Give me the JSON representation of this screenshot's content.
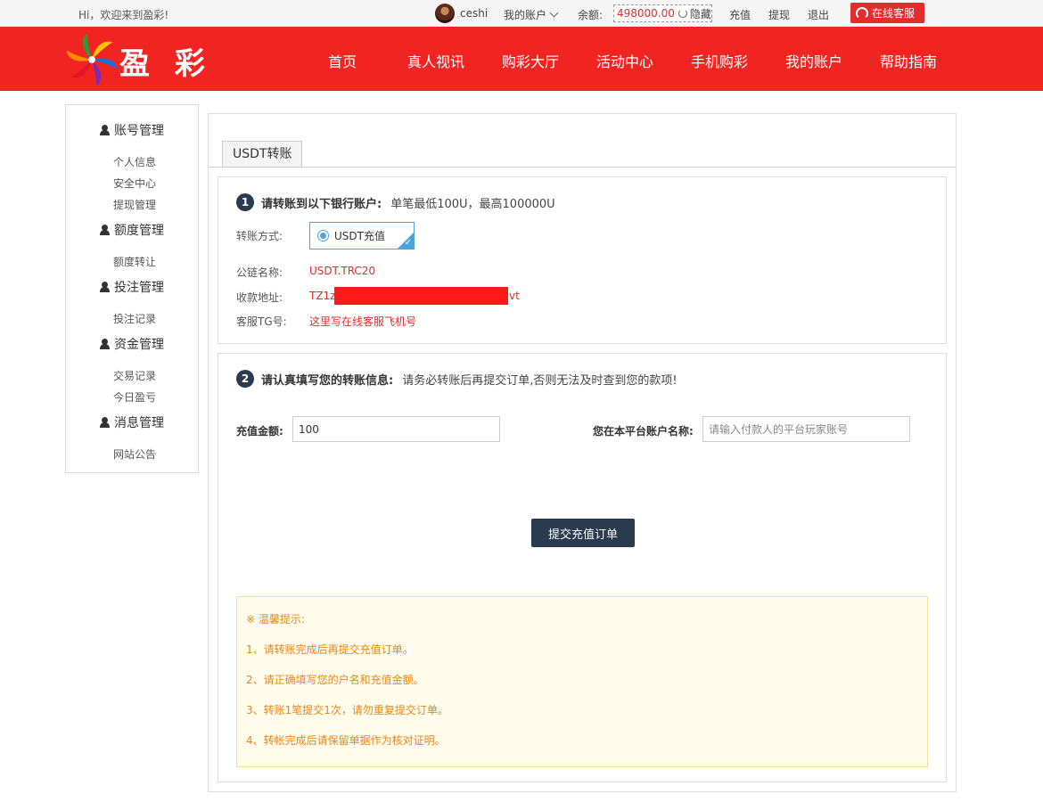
{
  "topbar": {
    "greeting": "Hi，欢迎来到盈彩!",
    "username": "ceshi",
    "my_account": "我的账户",
    "balance_label": "余额:",
    "balance": "498000.00",
    "hide": "隐藏",
    "links": [
      "充值",
      "提现",
      "退出"
    ],
    "service": "在线客服"
  },
  "header": {
    "logo_text": "盈 彩",
    "nav": [
      "首页",
      "真人视讯",
      "购彩大厅",
      "活动中心",
      "手机购彩",
      "我的账户",
      "帮助指南"
    ]
  },
  "sidebar": {
    "groups": [
      {
        "label": "账号管理",
        "items": [
          "个人信息",
          "安全中心",
          "提现管理"
        ]
      },
      {
        "label": "额度管理",
        "items": [
          "额度转让"
        ]
      },
      {
        "label": "投注管理",
        "items": [
          "投注记录"
        ]
      },
      {
        "label": "资金管理",
        "items": [
          "交易记录",
          "今日盈亏"
        ]
      },
      {
        "label": "消息管理",
        "items": [
          "网站公告"
        ]
      }
    ]
  },
  "main": {
    "tab": "USDT转账",
    "step1": {
      "num": "1",
      "title": "请转账到以下银行账户:",
      "subtitle": "单笔最低100U，最高100000U",
      "method_label": "转账方式:",
      "method_value": "USDT充值",
      "chain_label": "公链名称:",
      "chain_value": "USDT.TRC20",
      "address_label": "收款地址:",
      "address_start": "TZ1z",
      "address_end": "vt",
      "tg_label": "客服TG号:",
      "tg_value": "这里写在线客服飞机号"
    },
    "step2": {
      "num": "2",
      "title": "请认真填写您的转账信息:",
      "subtitle": "请务必转账后再提交订单,否则无法及时查到您的款项!",
      "amount_label": "充值金额:",
      "amount_value": "100",
      "account_label": "您在本平台账户名称:",
      "account_placeholder": "请输入付款人的平台玩家账号",
      "submit": "提交充值订单"
    },
    "tips": {
      "title": "※ 温馨提示:",
      "items": [
        "1、请转账完成后再提交充值订单。",
        "2、请正确填写您的户名和充值金额。",
        "3、转账1笔提交1次，请勿重复提交订单。",
        "4、转帐完成后请保留单据作为核对证明。"
      ]
    }
  }
}
